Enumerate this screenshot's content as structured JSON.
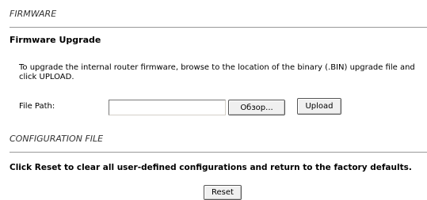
{
  "firmware_section": {
    "title": "FIRMWARE",
    "upgrade_title": "Firmware Upgrade",
    "description": "To upgrade the internal router firmware, browse to the location of the binary (.BIN) upgrade file and click UPLOAD.",
    "file_path_label": "File Path:",
    "file_path_value": "",
    "browse_label": "Обзор...",
    "upload_label": "Upload"
  },
  "config_section": {
    "title": "CONFIGURATION FILE",
    "reset_notice": "Click Reset to clear all user-defined configurations and return to the factory defaults.",
    "reset_label": "Reset"
  }
}
